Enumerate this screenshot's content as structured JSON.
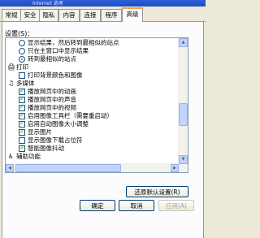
{
  "window": {
    "title": "Internet 选项"
  },
  "tabs": [
    {
      "label": "常规",
      "active": false
    },
    {
      "label": "安全",
      "active": false
    },
    {
      "label": "隐私",
      "active": false
    },
    {
      "label": "内容",
      "active": false
    },
    {
      "label": "连接",
      "active": false
    },
    {
      "label": "程序",
      "active": false
    },
    {
      "label": "高级",
      "active": true
    }
  ],
  "settings": {
    "label": "设置(S)：",
    "items": [
      {
        "type": "radio",
        "checked": false,
        "label": "显示结果，然后转到最相似的站点"
      },
      {
        "type": "radio",
        "checked": false,
        "label": "只在主窗口中显示结果"
      },
      {
        "type": "radio",
        "checked": true,
        "label": "转到最相似的站点"
      },
      {
        "type": "category",
        "icon": "printer-icon",
        "label": "打印"
      },
      {
        "type": "checkbox",
        "checked": false,
        "label": "打印背景颜色和图像"
      },
      {
        "type": "category",
        "icon": "multimedia-icon",
        "label": "多媒体"
      },
      {
        "type": "checkbox",
        "checked": true,
        "label": "播放网页中的动画"
      },
      {
        "type": "checkbox",
        "checked": true,
        "label": "播放网页中的声音"
      },
      {
        "type": "checkbox",
        "checked": true,
        "label": "播放网页中的视频"
      },
      {
        "type": "checkbox",
        "checked": true,
        "label": "启用图像工具栏（需要重启动）"
      },
      {
        "type": "checkbox",
        "checked": true,
        "label": "启用自动图像大小调整"
      },
      {
        "type": "checkbox",
        "checked": true,
        "label": "显示图片"
      },
      {
        "type": "checkbox",
        "checked": false,
        "label": "显示图像下载占位符"
      },
      {
        "type": "checkbox",
        "checked": true,
        "label": "智能图像抖动"
      },
      {
        "type": "category",
        "icon": "accessibility-icon",
        "label": "辅助功能"
      }
    ]
  },
  "buttons": {
    "restore": "还原默认设置(R)",
    "ok": "确定",
    "cancel": "取消",
    "apply": "应用(A)"
  }
}
